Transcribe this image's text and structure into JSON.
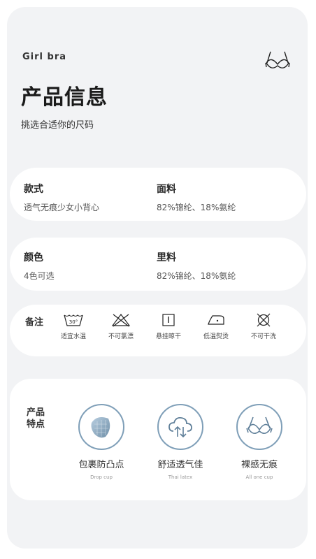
{
  "header": {
    "brand": "Girl bra",
    "title": "产品信息",
    "subtitle": "挑选合适你的尺码"
  },
  "info": [
    {
      "label": "款式",
      "value": "透气无痕少女小背心"
    },
    {
      "label": "面料",
      "value": "82%锦纶、18%氨纶"
    },
    {
      "label": "颜色",
      "value": "4色可选"
    },
    {
      "label": "里料",
      "value": "82%锦纶、18%氨纶"
    }
  ],
  "care": {
    "label": "备注",
    "items": [
      {
        "icon": "wash-30-icon",
        "text": "适宜水温",
        "temp": "30°"
      },
      {
        "icon": "no-bleach-icon",
        "text": "不可氯漂"
      },
      {
        "icon": "hang-dry-icon",
        "text": "悬挂晾干"
      },
      {
        "icon": "low-iron-icon",
        "text": "低温熨烫"
      },
      {
        "icon": "no-dry-clean-icon",
        "text": "不可干洗"
      }
    ]
  },
  "features": {
    "label_line1": "产品",
    "label_line2": "特点",
    "items": [
      {
        "icon": "cup-pad-icon",
        "title": "包裹防凸点",
        "subtitle": "Drop cup"
      },
      {
        "icon": "cloud-breathable-icon",
        "title": "舒适透气佳",
        "subtitle": "Thai latex"
      },
      {
        "icon": "bra-icon",
        "title": "裸感无痕",
        "subtitle": "All one cup"
      }
    ]
  },
  "colors": {
    "accent": "#7f9fb8",
    "background": "#f2f3f5"
  }
}
